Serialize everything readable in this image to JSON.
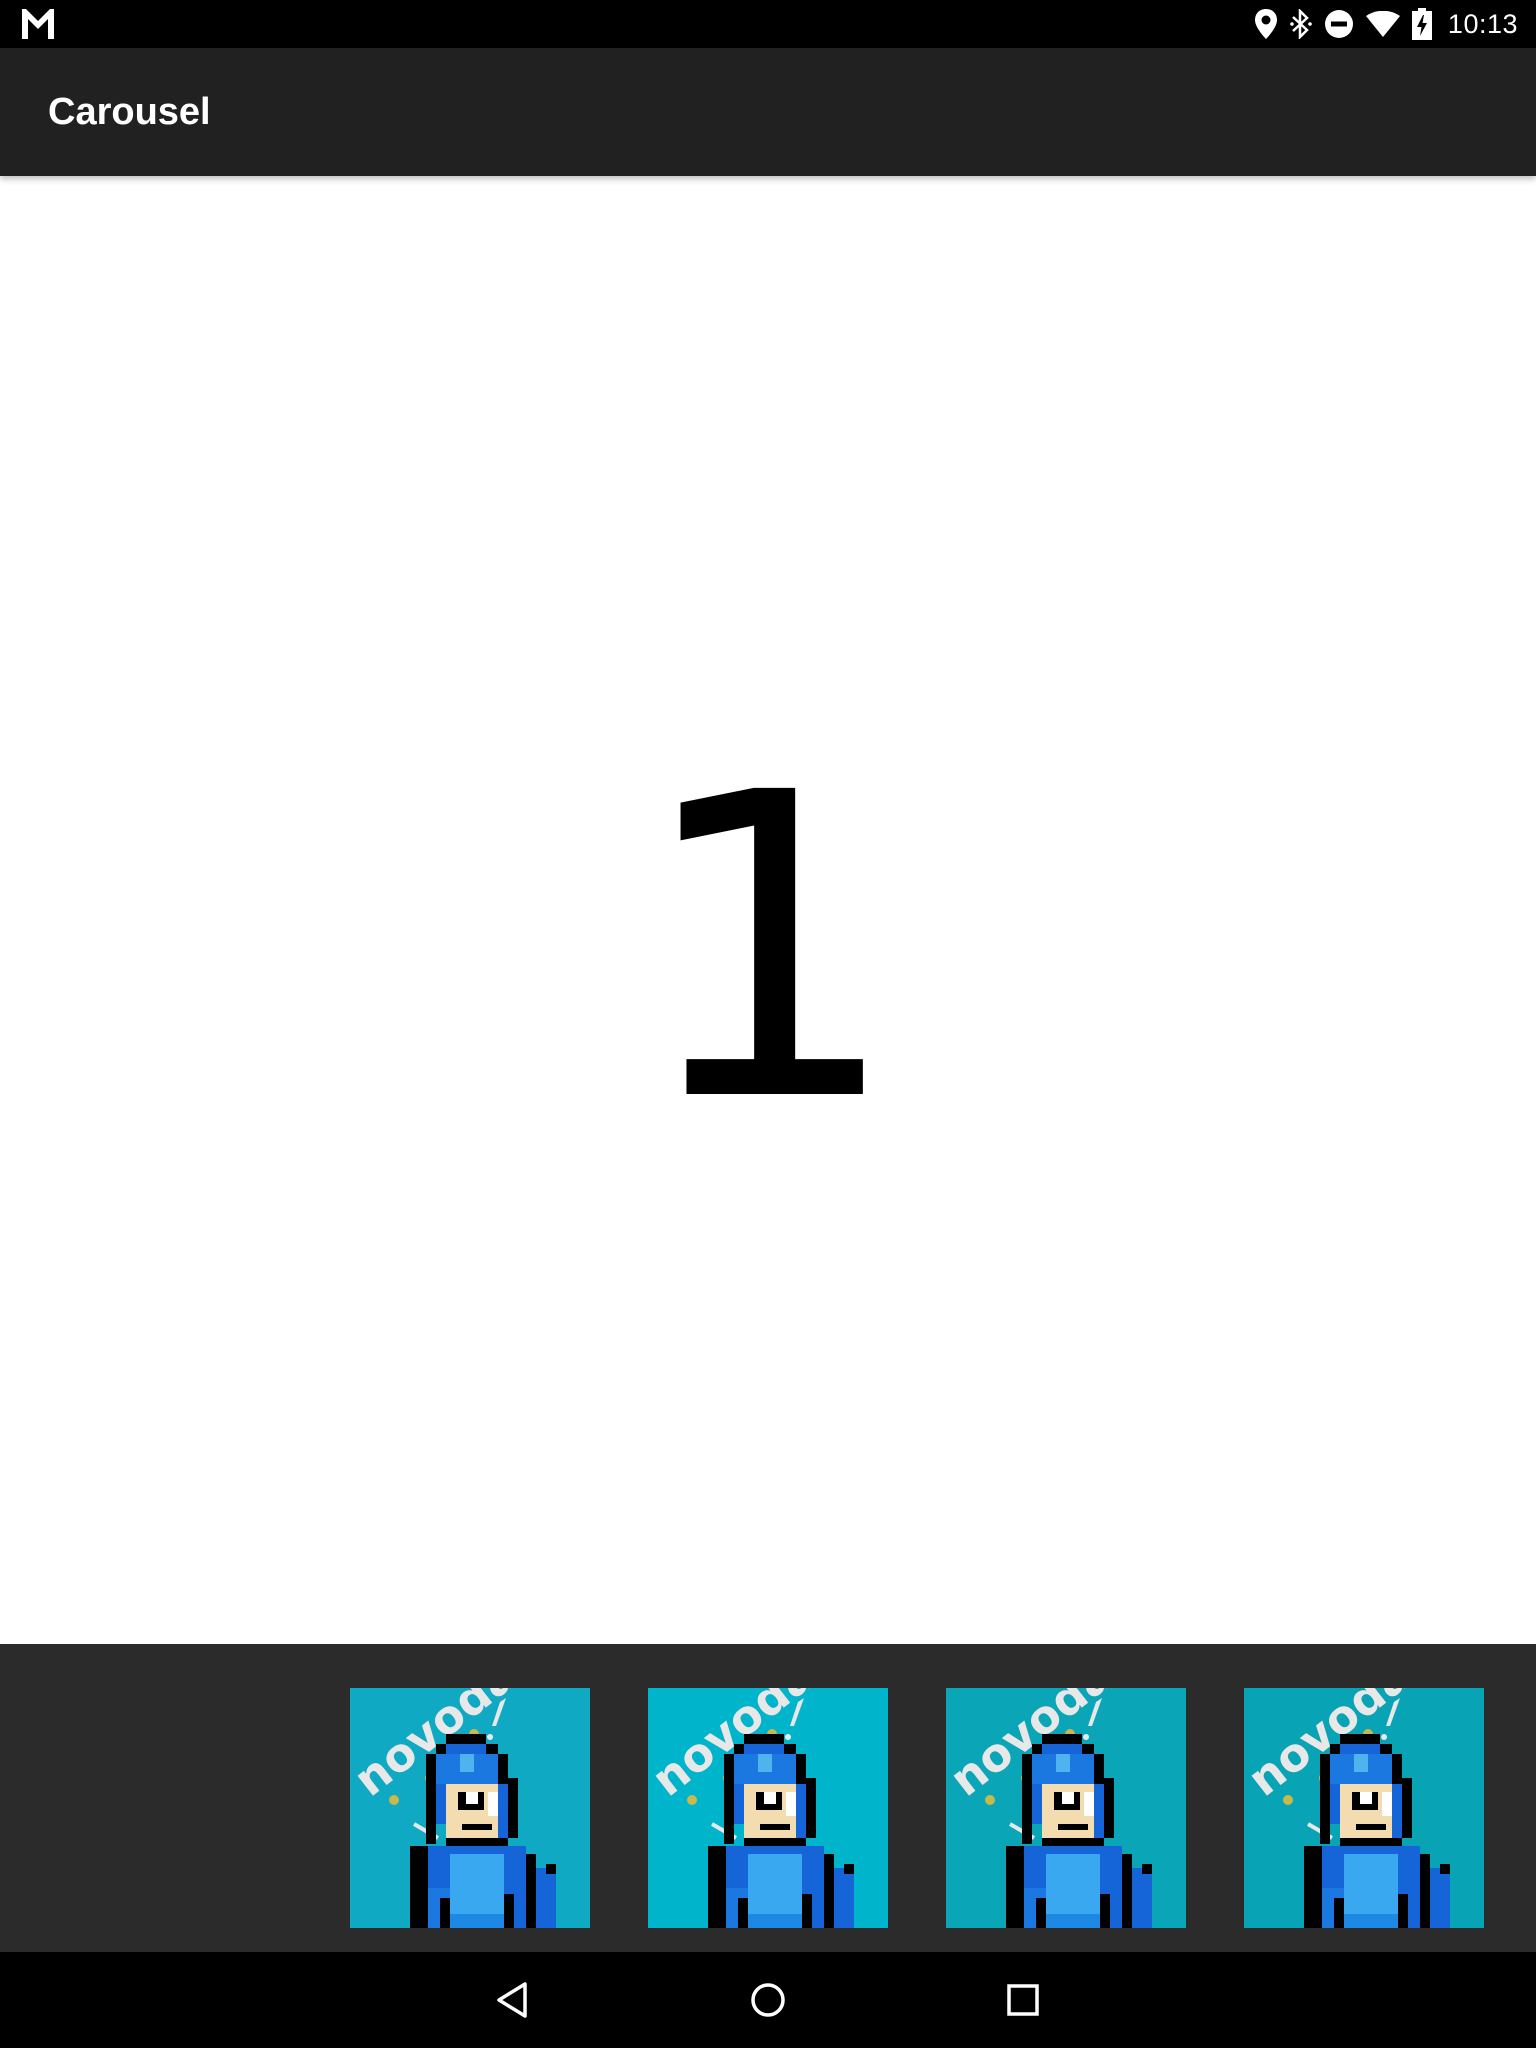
{
  "status_bar": {
    "time": "10:13",
    "left_icon": "gmail-icon",
    "right_icons": [
      "location-icon",
      "bluetooth-icon",
      "do-not-disturb-icon",
      "wifi-icon",
      "battery-charging-icon"
    ]
  },
  "app_bar": {
    "title": "Carousel",
    "background": "#212121"
  },
  "main": {
    "current_page": "1"
  },
  "carousel": {
    "background": "#2b2b2b",
    "thumbnails": [
      {
        "label": "novoda",
        "background": "#10a9c4"
      },
      {
        "label": "novoda",
        "background": "#00b4cc"
      },
      {
        "label": "novoda",
        "background": "#0aa6b8"
      },
      {
        "label": "novoda",
        "background": "#08a4b6"
      }
    ]
  },
  "nav_bar": {
    "buttons": [
      "back-icon",
      "home-icon",
      "recents-icon"
    ]
  }
}
